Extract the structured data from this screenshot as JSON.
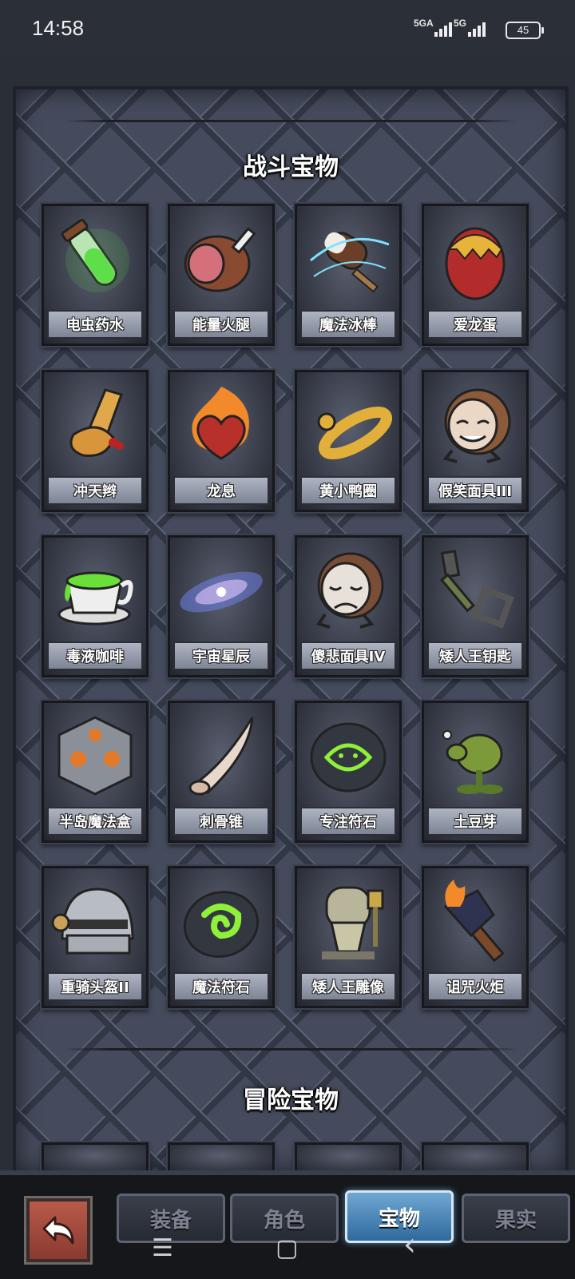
{
  "status_bar": {
    "time": "14:58",
    "net1": "5GA",
    "net2": "5G",
    "battery": "45"
  },
  "sections": [
    {
      "title": "战斗宝物"
    },
    {
      "title": "冒险宝物"
    }
  ],
  "items": [
    {
      "name": "电虫药水",
      "icon": "green-potion-icon"
    },
    {
      "name": "能量火腿",
      "icon": "ham-icon"
    },
    {
      "name": "魔法冰棒",
      "icon": "ice-pop-icon"
    },
    {
      "name": "爱龙蛋",
      "icon": "dragon-egg-icon"
    },
    {
      "name": "冲天辫",
      "icon": "pigtail-icon"
    },
    {
      "name": "龙息",
      "icon": "flaming-heart-icon"
    },
    {
      "name": "黄小鸭圈",
      "icon": "duck-ring-icon"
    },
    {
      "name": "假笑面具III",
      "icon": "smile-mask-icon"
    },
    {
      "name": "毒液咖啡",
      "icon": "poison-coffee-icon"
    },
    {
      "name": "宇宙星辰",
      "icon": "galaxy-icon"
    },
    {
      "name": "傻悲面具IV",
      "icon": "sad-mask-icon"
    },
    {
      "name": "矮人王钥匙",
      "icon": "key-icon"
    },
    {
      "name": "半岛魔法盒",
      "icon": "magic-cube-icon"
    },
    {
      "name": "刺骨锥",
      "icon": "bone-spike-icon"
    },
    {
      "name": "专注符石",
      "icon": "focus-rune-icon"
    },
    {
      "name": "土豆芽",
      "icon": "sprout-creature-icon"
    },
    {
      "name": "重骑头盔II",
      "icon": "knight-helmet-icon"
    },
    {
      "name": "魔法符石",
      "icon": "magic-rune-icon"
    },
    {
      "name": "矮人王雕像",
      "icon": "dwarf-statue-icon"
    },
    {
      "name": "诅咒火炬",
      "icon": "cursed-torch-icon"
    }
  ],
  "tabs": [
    {
      "label": "装备",
      "active": false
    },
    {
      "label": "角色",
      "active": false
    },
    {
      "label": "宝物",
      "active": true
    },
    {
      "label": "果实",
      "active": false
    }
  ],
  "system_nav": {
    "menu": "☰",
    "home": "▢",
    "back": "‹"
  }
}
